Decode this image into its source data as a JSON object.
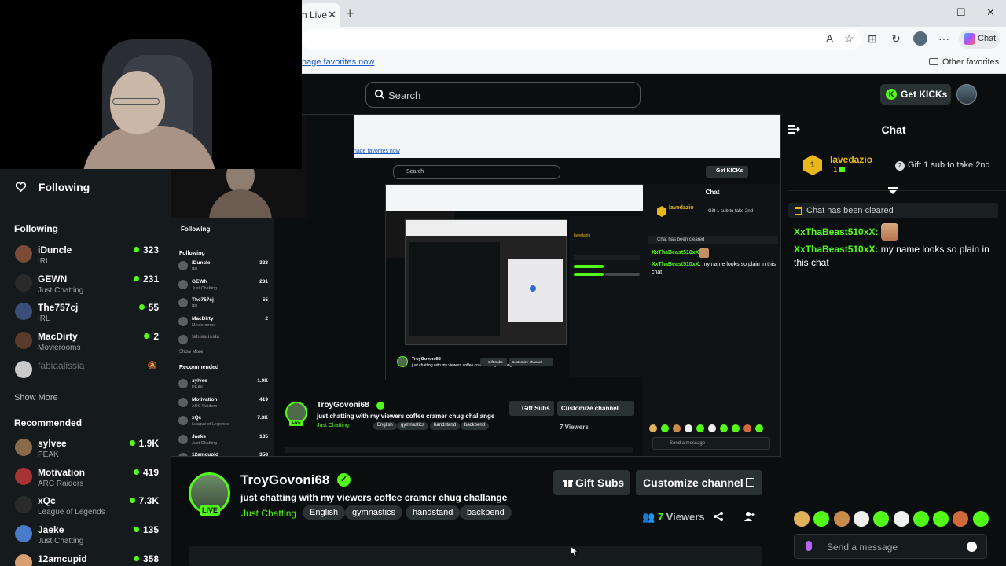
{
  "browser": {
    "tab_label": "h Live",
    "favorites_link": "nage favorites now",
    "other_favorites": "Other favorites",
    "copilot_label": "Chat"
  },
  "header": {
    "search_placeholder": "Search",
    "get_kicks": "Get KICKs"
  },
  "sidebar": {
    "title": "Following",
    "following_label": "Following",
    "following": [
      {
        "name": "iDuncle",
        "category": "IRL",
        "viewers": "323"
      },
      {
        "name": "GEWN",
        "category": "Just Chatting",
        "viewers": "231"
      },
      {
        "name": "The757cj",
        "category": "IRL",
        "viewers": "55"
      },
      {
        "name": "MacDirty",
        "category": "Movierooms",
        "viewers": "2"
      },
      {
        "name": "fabiaalissia",
        "category": "",
        "viewers": ""
      }
    ],
    "show_more": "Show More",
    "recommended_label": "Recommended",
    "recommended": [
      {
        "name": "sylvee",
        "category": "PEAK",
        "viewers": "1.9K"
      },
      {
        "name": "Motivation",
        "category": "ARC Raiders",
        "viewers": "419"
      },
      {
        "name": "xQc",
        "category": "League of Legends",
        "viewers": "7.3K"
      },
      {
        "name": "Jaeke",
        "category": "Just Chatting",
        "viewers": "135"
      },
      {
        "name": "12amcupid",
        "category": "",
        "viewers": "358"
      }
    ]
  },
  "channel": {
    "name": "TroyGovoni68",
    "live": "LIVE",
    "title": "just chatting with my viewers coffee cramer chug challange",
    "category": "Just Chatting",
    "tags": [
      "English",
      "gymnastics",
      "handstand",
      "backbend"
    ],
    "gift_subs": "Gift Subs",
    "customize": "Customize channel",
    "viewers": "7",
    "viewers_label": "Viewers"
  },
  "nested": {
    "channel_name": "TroyGovoni68",
    "title": "just chatting with my viewers coffee cramer chug challange",
    "category": "Just Chatting",
    "tags": [
      "English",
      "gymnastics",
      "handstand",
      "backbend"
    ],
    "gift_subs": "Gift Subs",
    "customize": "Customize channel",
    "viewers": "7 Viewers",
    "search": "Search",
    "get_kicks": "Get KICKs",
    "chat_title": "Chat",
    "following": "Following",
    "recommended": "Recommended",
    "show_more": "Show More",
    "send": "Send a message",
    "pin_name": "lavedazio",
    "pin_gift": "Gift 1 sub to take 2nd",
    "cleared": "Chat has been cleared",
    "msg_user": "XxThaBeast510xX:",
    "msg_text": "my name looks so plain in this chat",
    "fav": "nage favorites now",
    "items": [
      {
        "name": "iDuncle",
        "cat": "IRL",
        "v": "323"
      },
      {
        "name": "GEWN",
        "cat": "Just Chatting",
        "v": "231"
      },
      {
        "name": "The757cj",
        "cat": "IRL",
        "v": "55"
      },
      {
        "name": "MacDirty",
        "cat": "Movierooms",
        "v": "2"
      },
      {
        "name": "fabiaalissia",
        "cat": "",
        "v": ""
      }
    ],
    "rec": [
      {
        "name": "sylvee",
        "cat": "PEAK",
        "v": "1.9K"
      },
      {
        "name": "Motivation",
        "cat": "ARC Raiders",
        "v": "419"
      },
      {
        "name": "xQc",
        "cat": "League of Legends",
        "v": "7.3K"
      },
      {
        "name": "Jaeke",
        "cat": "Just Chatting",
        "v": "135"
      },
      {
        "name": "12amcupid",
        "cat": "",
        "v": "358"
      }
    ]
  },
  "chat": {
    "title": "Chat",
    "pinned_user": "lavedazio",
    "pinned_count": "1",
    "pinned_rank": "1",
    "pinned_gift": "Gift 1 sub to take 2nd",
    "gift_count": "2",
    "cleared": "Chat has been cleared",
    "messages": [
      {
        "user": "XxThaBeast510xX:",
        "text": ""
      },
      {
        "user": "XxThaBeast510xX:",
        "text": "my name looks so plain in this chat"
      }
    ],
    "send_placeholder": "Send a message"
  },
  "colors": {
    "accent": "#53fc18",
    "background": "#0b0e0f",
    "panel": "#151a1c",
    "gold": "#e8b81a"
  }
}
